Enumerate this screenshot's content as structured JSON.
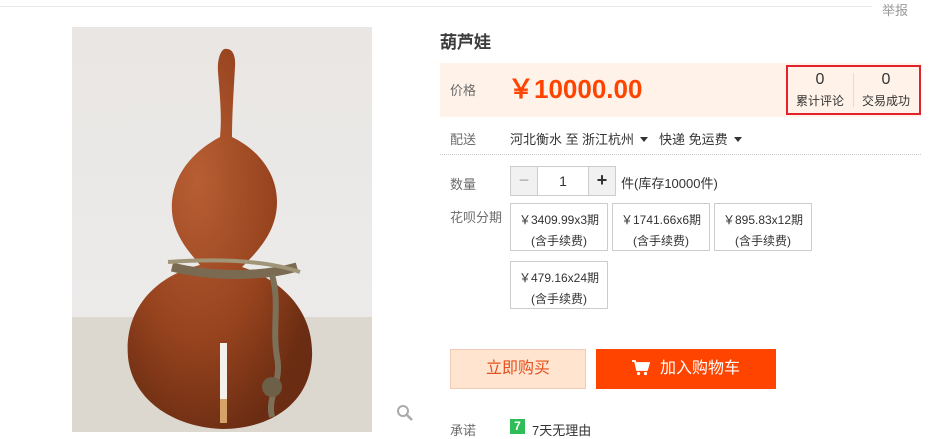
{
  "header": {
    "report_label": "举报"
  },
  "product": {
    "title": "葫芦娃"
  },
  "price": {
    "label": "价格",
    "value": "￥10000.00"
  },
  "stats": {
    "reviews": {
      "count": "0",
      "label": "累计评论"
    },
    "sales": {
      "count": "0",
      "label": "交易成功"
    }
  },
  "delivery": {
    "label": "配送",
    "from": "河北衡水 至",
    "to": "浙江杭州",
    "shipping": "快递 免运费"
  },
  "quantity": {
    "label": "数量",
    "minus": "−",
    "value": "1",
    "plus": "+",
    "stock": "件(库存10000件)"
  },
  "installments": {
    "label": "花呗分期",
    "plans": [
      {
        "amount": "￥3409.99x3期",
        "fee": "(含手续费)"
      },
      {
        "amount": "￥1741.66x6期",
        "fee": "(含手续费)"
      },
      {
        "amount": "￥895.83x12期",
        "fee": "(含手续费)"
      },
      {
        "amount": "￥479.16x24期",
        "fee": "(含手续费)"
      }
    ]
  },
  "actions": {
    "buy_now": "立即购买",
    "add_to_cart": "加入购物车"
  },
  "promise": {
    "label": "承诺",
    "badge": "7",
    "text": "7天无理由"
  },
  "icons": {
    "zoom": "magnifier-icon",
    "cart": "shopping-cart-icon",
    "caret": "caret-down-icon"
  },
  "colors": {
    "accent": "#ff4400",
    "price_bg": "#fff2e8",
    "highlight_border": "#e3222b",
    "promise_green": "#2ebd56"
  }
}
